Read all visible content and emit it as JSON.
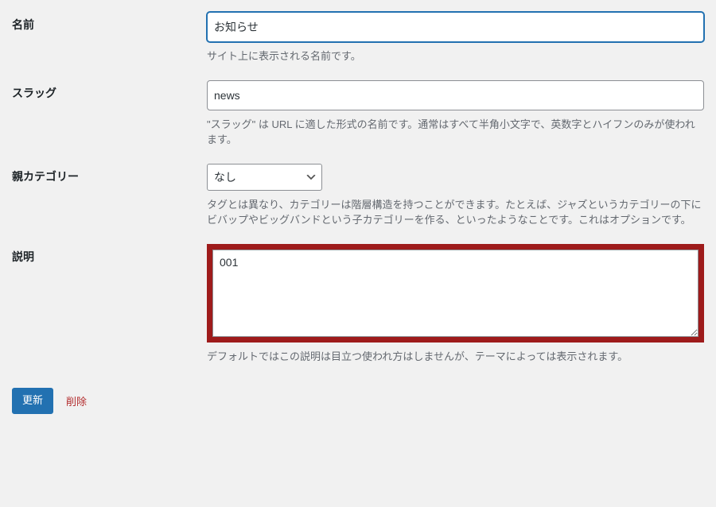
{
  "fields": {
    "name": {
      "label": "名前",
      "value": "お知らせ",
      "help": "サイト上に表示される名前です。"
    },
    "slug": {
      "label": "スラッグ",
      "value": "news",
      "help": "\"スラッグ\" は URL に適した形式の名前です。通常はすべて半角小文字で、英数字とハイフンのみが使われます。"
    },
    "parent": {
      "label": "親カテゴリー",
      "selected": "なし",
      "help": "タグとは異なり、カテゴリーは階層構造を持つことができます。たとえば、ジャズというカテゴリーの下にビバップやビッグバンドという子カテゴリーを作る、といったようなことです。これはオプションです。"
    },
    "description": {
      "label": "説明",
      "value": "001",
      "help": "デフォルトではこの説明は目立つ使われ方はしませんが、テーマによっては表示されます。"
    }
  },
  "actions": {
    "update": "更新",
    "delete": "削除"
  }
}
